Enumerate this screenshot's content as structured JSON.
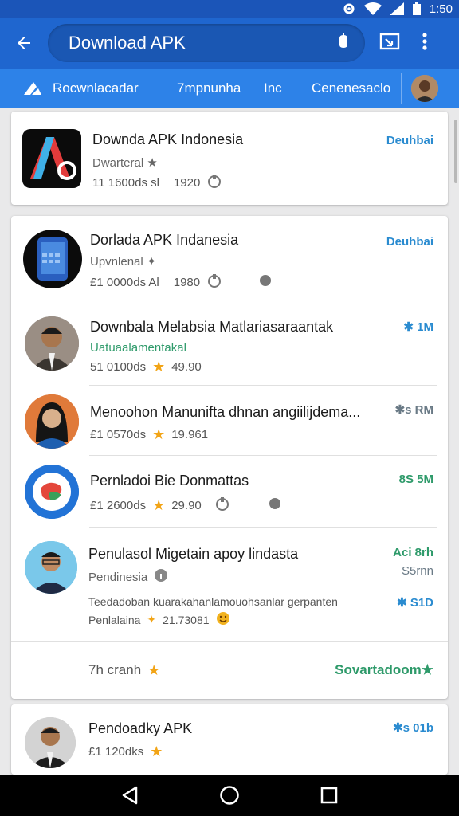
{
  "status_bar": {
    "time": "1:50"
  },
  "app_bar": {
    "search_text": "Download APK"
  },
  "tabs": [
    {
      "label": "Rocwnlacadar"
    },
    {
      "label": "7mpnunha"
    },
    {
      "label": "Inc"
    },
    {
      "label": "Cenenesaclo"
    }
  ],
  "cards": {
    "first": {
      "title": "Downda APK Indonesia",
      "subtitle": "Dwarteral ★",
      "meta_count": "11 1600ds sl",
      "meta_number": "1920",
      "action": "Deuhbai"
    },
    "second_rows": [
      {
        "title": "Dorlada APK Indanesia",
        "subtitle": "Upvnlenal ✦",
        "meta_count": "£1 0000ds Al",
        "meta_number": "1980",
        "action": "Deuhbai"
      },
      {
        "title": "Downbala Melabsia Matlariasaraantak",
        "subtitle": "Uatuaalamentakal",
        "meta_count": "51 0100ds",
        "meta_number": "49.90",
        "action": "✱ 1M"
      },
      {
        "title": "Menoohon Manunifta dhnan angiilijdema...",
        "meta_count": "£1 0570ds",
        "meta_number": "19.961",
        "action": "✱s RM"
      },
      {
        "title": "Pernladoi Bie Donmattas",
        "meta_count": "£1 2600ds",
        "meta_number": "29.90",
        "action": "8S 5M"
      },
      {
        "title": "Penulasol Migetain apoy lindasta",
        "subtitle": "Pendinesia",
        "action": "Aci 8rh",
        "action2": "S5rnn",
        "desc": "Teedadoban kuarakahanlamouohsanlar gerpanten",
        "desc2_label": "Penlalaina",
        "desc2_number": "21.73081",
        "desc_action": "✱ S1D"
      }
    ],
    "second_footer": {
      "left": "7h cranh",
      "right": "Sovartadoom★"
    },
    "third": {
      "title": "Pendoadky APK",
      "meta_count": "£1 120dks",
      "action": "✱s 01b"
    }
  },
  "colors": {
    "primary": "#1f66cf",
    "accent_text": "#2a8bd0",
    "star": "#f2a416"
  }
}
